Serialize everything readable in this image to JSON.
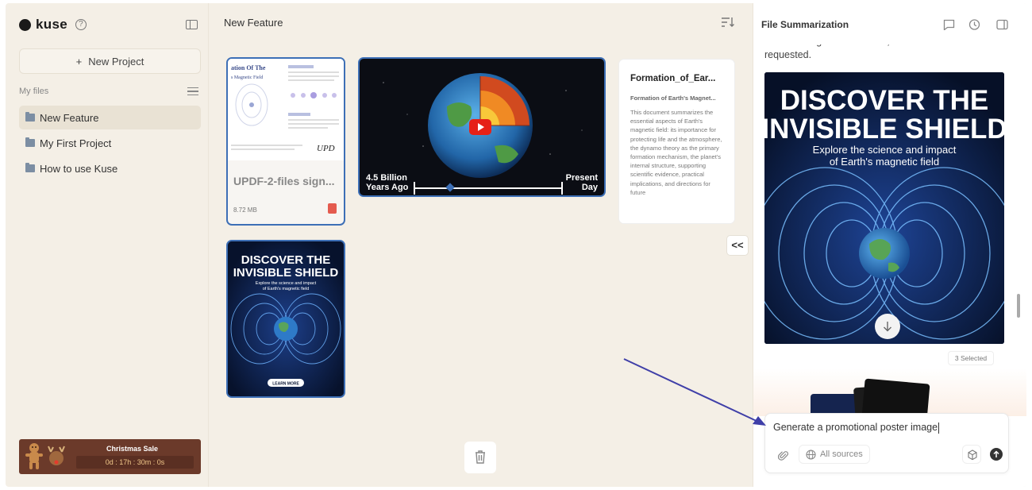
{
  "app": {
    "name": "kuse"
  },
  "sidebar": {
    "new_project_label": "New Project",
    "my_files_label": "My files",
    "items": [
      {
        "label": "New Feature",
        "active": true
      },
      {
        "label": "My First Project",
        "active": false
      },
      {
        "label": "How to use Kuse",
        "active": false
      }
    ],
    "sale": {
      "title": "Christmas Sale",
      "timer": "0d : 17h : 30m : 0s"
    }
  },
  "main": {
    "title": "New Feature",
    "pdf_card": {
      "name": "UPDF-2-files sign...",
      "size": "8.72 MB",
      "thumb_title": "ation Of The",
      "thumb_sub": "s Magnetic Field",
      "thumb_logo": "UPD"
    },
    "video_card": {
      "left_label_1": "4.5 Billion",
      "left_label_2": "Years Ago",
      "right_label_1": "Present",
      "right_label_2": "Day"
    },
    "doc_card": {
      "title": "Formation_of_Ear...",
      "subtitle": "Formation of Earth's Magnet...",
      "body": "This document summarizes the essential aspects of Earth's magnetic field: its importance for protecting life and the atmosphere, the dynamo theory as the primary formation mechanism, the planet's internal structure, supporting scientific evidence, practical implications, and directions for future"
    },
    "poster_card": {
      "title_1": "DISCOVER THE",
      "title_2": "INVISIBLE SHIELD",
      "subtitle_1": "Explore the science and impact",
      "subtitle_2": "of Earth's magnetic field",
      "button": "LEARN MORE"
    },
    "collapse_label": "<<"
  },
  "panel": {
    "title": "File Summarization",
    "text": "abstract magnetic field lines, and a clear CTA as requested.",
    "poster": {
      "title_1": "DISCOVER THE",
      "title_2": "INVISIBLE SHIELD",
      "subtitle_1": "Explore the science and impact",
      "subtitle_2": "of Earth's magnetic field"
    },
    "selected_badge": "3 Selected",
    "chat_input": "Generate a promotional poster image",
    "sources_label": "All sources"
  },
  "colors": {
    "accent": "#3d6fb6",
    "background": "#f4efe6",
    "arrow": "#3f3fa8",
    "sale": "#6b3a2a"
  }
}
